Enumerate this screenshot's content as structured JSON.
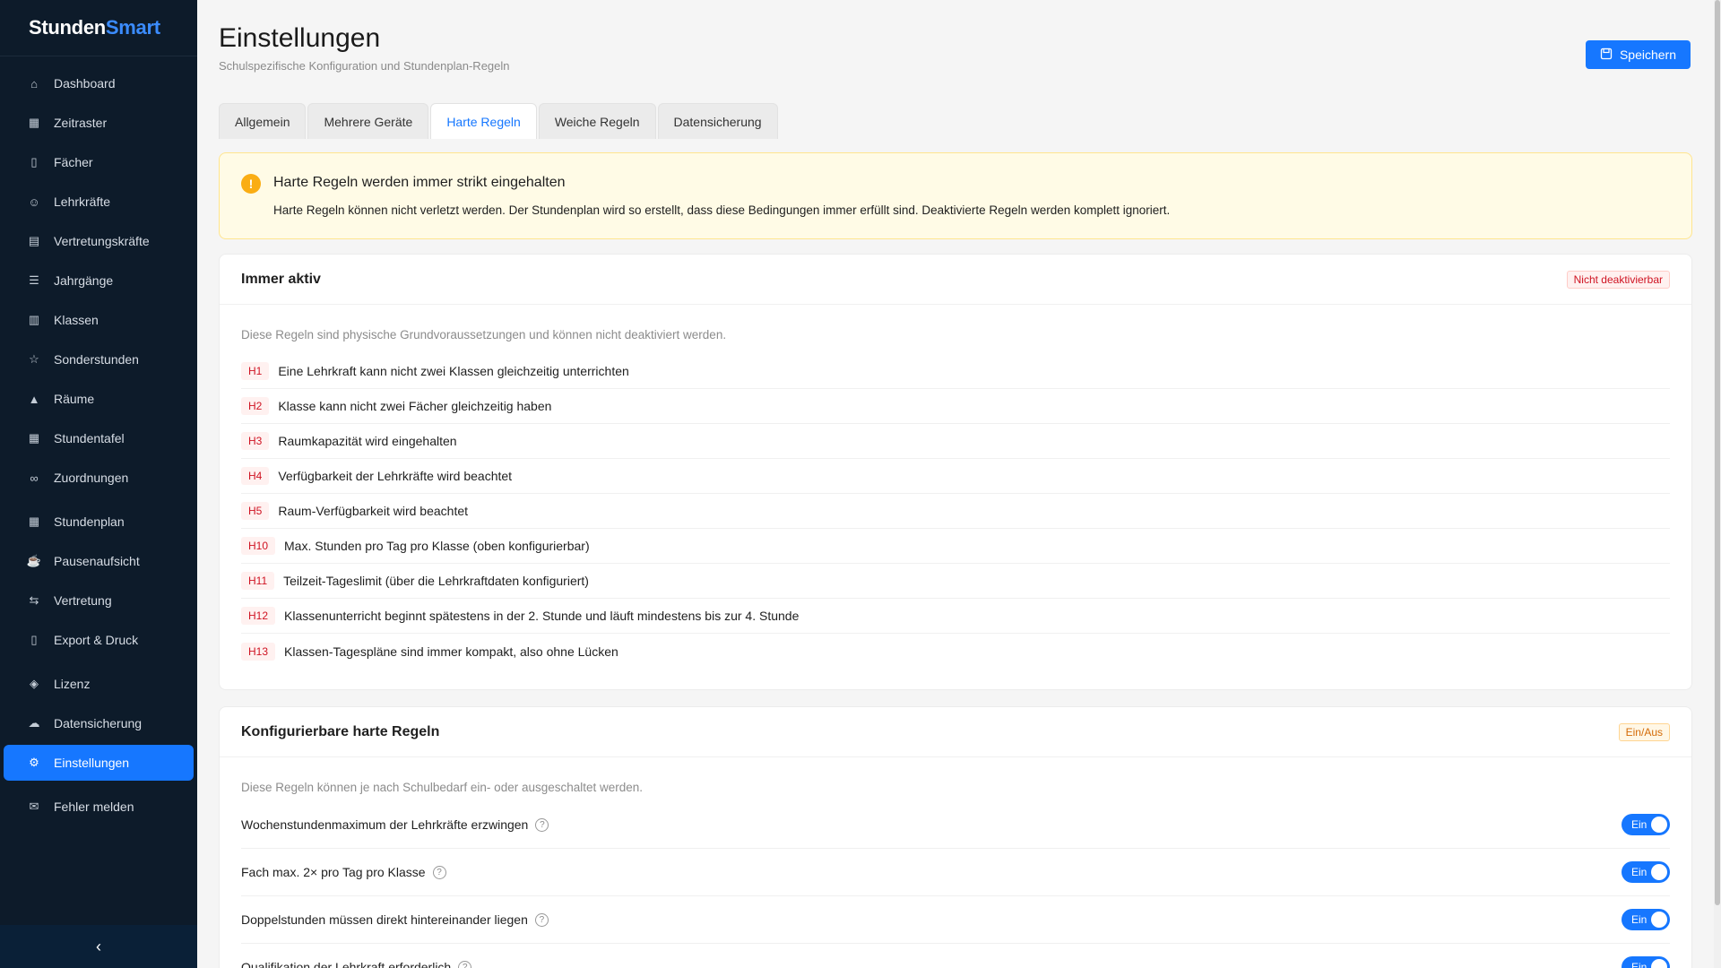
{
  "app": {
    "logo_a": "Stunden",
    "logo_b": "Smart"
  },
  "sidebar": {
    "items": [
      {
        "label": "Dashboard",
        "icon": "home-icon"
      },
      {
        "label": "Zeitraster",
        "icon": "calendar-icon"
      },
      {
        "label": "Fächer",
        "icon": "book-icon"
      },
      {
        "label": "Lehrkräfte",
        "icon": "user-icon"
      },
      {
        "label": "Vertretungskräfte",
        "icon": "document-icon"
      },
      {
        "label": "Jahrgänge",
        "icon": "list-icon"
      },
      {
        "label": "Klassen",
        "icon": "book-open-icon"
      },
      {
        "label": "Sonderstunden",
        "icon": "star-icon"
      },
      {
        "label": "Räume",
        "icon": "bank-icon"
      },
      {
        "label": "Stundentafel",
        "icon": "table-icon"
      },
      {
        "label": "Zuordnungen",
        "icon": "link-icon"
      },
      {
        "label": "Stundenplan",
        "icon": "calendar-icon"
      },
      {
        "label": "Pausenaufsicht",
        "icon": "coffee-icon"
      },
      {
        "label": "Vertretung",
        "icon": "swap-icon"
      },
      {
        "label": "Export & Druck",
        "icon": "file-export-icon"
      },
      {
        "label": "Lizenz",
        "icon": "shield-icon"
      },
      {
        "label": "Datensicherung",
        "icon": "cloud-icon"
      },
      {
        "label": "Einstellungen",
        "icon": "gear-icon"
      },
      {
        "label": "Fehler melden",
        "icon": "mail-icon"
      }
    ],
    "collapse_glyph": "‹"
  },
  "header": {
    "title": "Einstellungen",
    "subtitle": "Schulspezifische Konfiguration und Stundenplan-Regeln",
    "save_label": "Speichern"
  },
  "tabs": [
    "Allgemein",
    "Mehrere Geräte",
    "Harte Regeln",
    "Weiche Regeln",
    "Datensicherung"
  ],
  "alert": {
    "icon": "!",
    "title": "Harte Regeln werden immer strikt eingehalten",
    "description": "Harte Regeln können nicht verletzt werden. Der Stundenplan wird so erstellt, dass diese Bedingungen immer erfüllt sind. Deaktivierte Regeln werden komplett ignoriert."
  },
  "always_active": {
    "title": "Immer aktiv",
    "tag": "Nicht deaktivierbar",
    "description": "Diese Regeln sind physische Grundvoraussetzungen und können nicht deaktiviert werden.",
    "rules": [
      {
        "code": "H1",
        "text": "Eine Lehrkraft kann nicht zwei Klassen gleichzeitig unterrichten"
      },
      {
        "code": "H2",
        "text": "Klasse kann nicht zwei Fächer gleichzeitig haben"
      },
      {
        "code": "H3",
        "text": "Raumkapazität wird eingehalten"
      },
      {
        "code": "H4",
        "text": "Verfügbarkeit der Lehrkräfte wird beachtet"
      },
      {
        "code": "H5",
        "text": "Raum-Verfügbarkeit wird beachtet"
      },
      {
        "code": "H10",
        "text": "Max. Stunden pro Tag pro Klasse (oben konfigurierbar)"
      },
      {
        "code": "H11",
        "text": "Teilzeit-Tageslimit (über die Lehrkraftdaten konfiguriert)"
      },
      {
        "code": "H12",
        "text": "Klassenunterricht beginnt spätestens in der 2. Stunde und läuft mindestens bis zur 4. Stunde"
      },
      {
        "code": "H13",
        "text": "Klassen-Tagespläne sind immer kompakt, also ohne Lücken"
      }
    ]
  },
  "configurable": {
    "title": "Konfigurierbare harte Regeln",
    "tag": "Ein/Aus",
    "description": "Diese Regeln können je nach Schulbedarf ein- oder ausgeschaltet werden.",
    "rules": [
      {
        "label": "Wochenstundenmaximum der Lehrkräfte erzwingen",
        "state": "Ein"
      },
      {
        "label": "Fach max. 2× pro Tag pro Klasse",
        "state": "Ein"
      },
      {
        "label": "Doppelstunden müssen direkt hintereinander liegen",
        "state": "Ein"
      },
      {
        "label": "Qualifikation der Lehrkraft erforderlich",
        "state": "Ein"
      }
    ]
  },
  "colors": {
    "accent": "#1677ff",
    "sidebar_bg": "#0d1b2a",
    "warning": "#faad14"
  }
}
